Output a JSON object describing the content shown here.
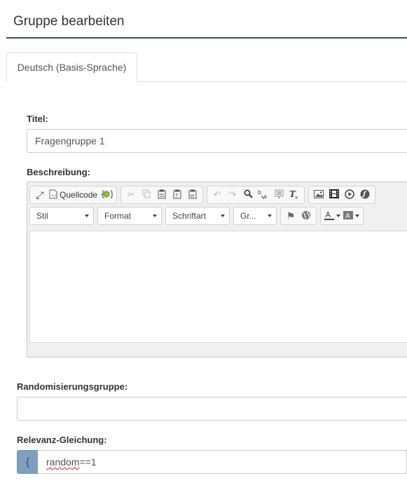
{
  "page": {
    "title": "Gruppe bearbeiten"
  },
  "tabs": [
    {
      "label": "Deutsch (Basis-Sprache)"
    }
  ],
  "form": {
    "title_label": "Titel:",
    "title_value": "Fragengruppe 1",
    "description_label": "Beschreibung:",
    "randomization_label": "Randomisierungsgruppe:",
    "randomization_value": "",
    "relevance_label": "Relevanz-Gleichung:",
    "relevance_brace": "{",
    "relevance_value_word": "random",
    "relevance_value_rest": "==1"
  },
  "editor": {
    "source_label": "Quellcode",
    "style_combo": "Stil",
    "format_combo": "Format",
    "font_combo": "Schriftart",
    "size_combo": "Gr..."
  },
  "icons": {
    "maximize": "⤢",
    "cut": "✂",
    "undo": "↶",
    "redo": "↷",
    "find": "🔍",
    "flag": "⚑",
    "globe": "◍",
    "play": "◉"
  },
  "colors": {
    "title_rule": "#2c5565",
    "brace_addon": "#7f9fbf"
  }
}
